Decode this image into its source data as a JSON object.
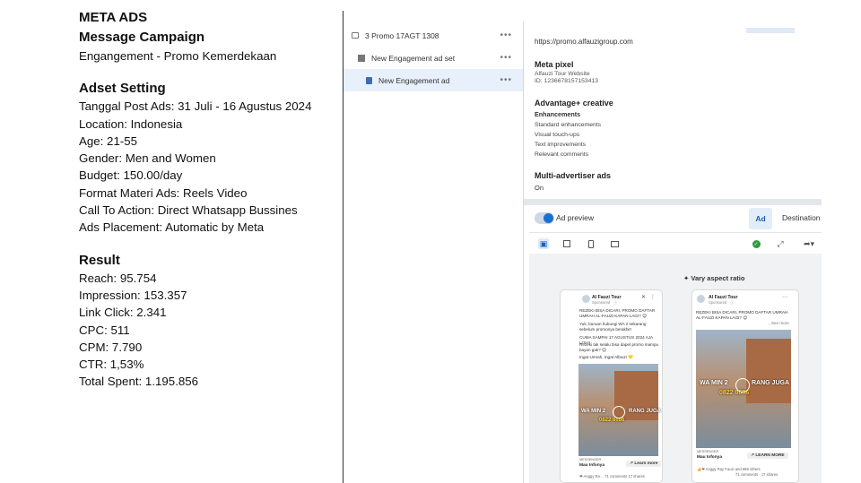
{
  "campaign": {
    "platform": "META ADS",
    "type": "Message Campaign",
    "objective": "Engangement - Promo Kemerdekaan"
  },
  "adset": {
    "heading": "Adset Setting",
    "lines": [
      "Tanggal Post Ads: 31 Juli - 16 Agustus 2024",
      "Location: Indonesia",
      "Age: 21-55",
      "Gender: Men and Women",
      "Budget: 150.00/day",
      "Format Materi Ads: Reels Video",
      "Call To Action: Direct Whatsapp Bussines",
      "Ads Placement: Automatic by Meta"
    ]
  },
  "result": {
    "heading": "Result",
    "lines": [
      "Reach: 95.754",
      "Impression: 153.357",
      "Link Click: 2.341",
      "CPC: 511",
      "CPM: 7.790",
      "CTR: 1,53%",
      "Total Spent: 1.195.856"
    ]
  },
  "tree": {
    "campaign_label": "3 Promo 17AGT 1308",
    "adset_label": "New Engagement ad set",
    "ad_label": "New Engagement ad",
    "more": "•••"
  },
  "info": {
    "url": "https://promo.alfauzigroup.com",
    "pixel_title": "Meta pixel",
    "pixel_name": "Alfauzi Tour Website",
    "pixel_id": "ID: 1236678157153413",
    "creative_title": "Advantage+ creative",
    "enh_title": "Enhancements",
    "enh_items": [
      "Standard enhancements",
      "Visual touch-ups",
      "Text improvements",
      "Relevant comments"
    ],
    "multi_title": "Multi-advertiser ads",
    "multi_value": "On"
  },
  "preview": {
    "label": "Ad preview",
    "tab_ad": "Ad",
    "tab_dest": "Destination",
    "vary": "✦ Vary aspect ratio",
    "cards": [
      {
        "name": "Al Fauzi Tour",
        "sponsored": "Sponsored · ⓘ",
        "text1": "REZEKI BISA DICARI, PROMO DAFTAR UMRAH AL-FAUZI KAPAN LAGI? 😊",
        "text2": "Yuk, buruan hubungi WA 2 sekarang sebelum promonya berakhir!",
        "text3": "CUMA SAMPAI 17 AGUSTUS 2024 AJA LOH!!",
        "text4": "Rezeki tak selalu bisa dapet promo mampu bayan gak? 😊",
        "text5": "Ingat Umrah, Ingat Alfauzi 💛",
        "cap": "WA MIN 2",
        "cap_b": "RANG JUGA",
        "cap2": "0822 8686",
        "msgr": "MESSENGER",
        "msgt": "Mau Infonya",
        "btn": "↗ Learn more",
        "foot": "❤ Anggy Ra… 71 comments 17 shares"
      },
      {
        "name": "Al Fauzi Tour",
        "sponsored": "Sponsored · ⓘ",
        "text1": "REZEKI BISA DICARI, PROMO DAFTAR UMRAH AL-FAUZI KAPAN LAGI? 😊",
        "see_more": "...See more",
        "cap": "WA MIN 2",
        "cap_b": "RANG JUGA",
        "cap2": "0822 8686",
        "msgr": "MESSENGER",
        "msgt": "Mau Infonya",
        "btn": "↗ LEARN MORE",
        "foot": "👍❤ Anggy Ray Fauzi and 669 others",
        "foot2": "71 comments · 17 shares"
      }
    ]
  }
}
